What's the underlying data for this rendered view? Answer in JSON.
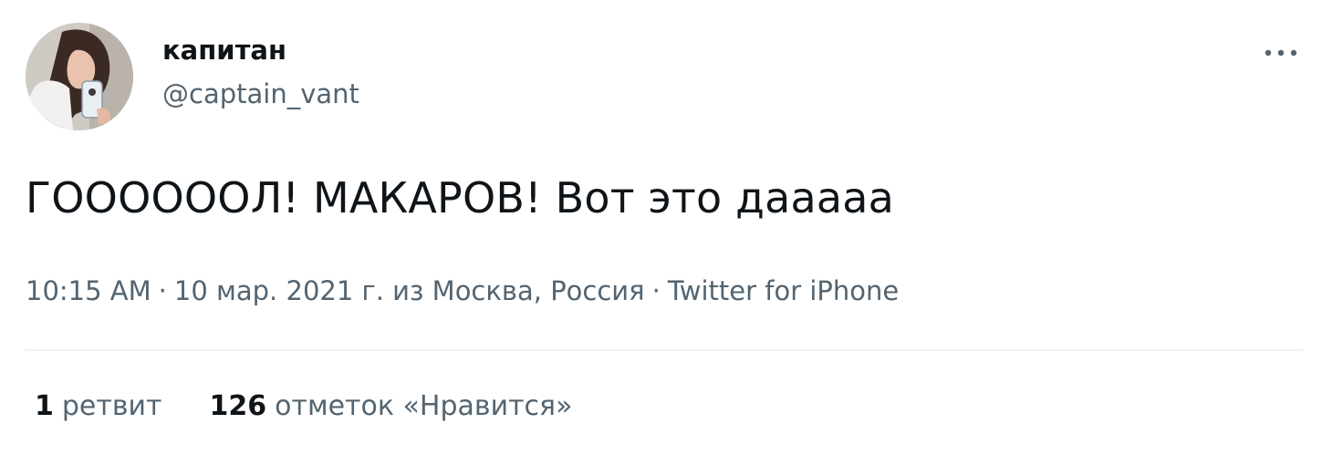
{
  "author": {
    "name": "капитан",
    "handle": "@captain_vant"
  },
  "icons": {
    "avatar": "profile-photo",
    "more": "more-horizontal-icon"
  },
  "tweet": {
    "text": "ГООООООЛ! МАКАРОВ! Вот это даaааа"
  },
  "meta": {
    "time": "10:15 AM",
    "separator": "·",
    "date_location": "10 мар. 2021 г. из Москва, Россия",
    "source": "Twitter for iPhone"
  },
  "stats": {
    "retweets_count": "1",
    "retweets_label": "ретвит",
    "likes_count": "126",
    "likes_label": "отметок «Нравится»"
  },
  "colors": {
    "text_primary": "#0f1419",
    "text_secondary": "#536471",
    "divider": "#eff3f4",
    "background": "#ffffff"
  }
}
